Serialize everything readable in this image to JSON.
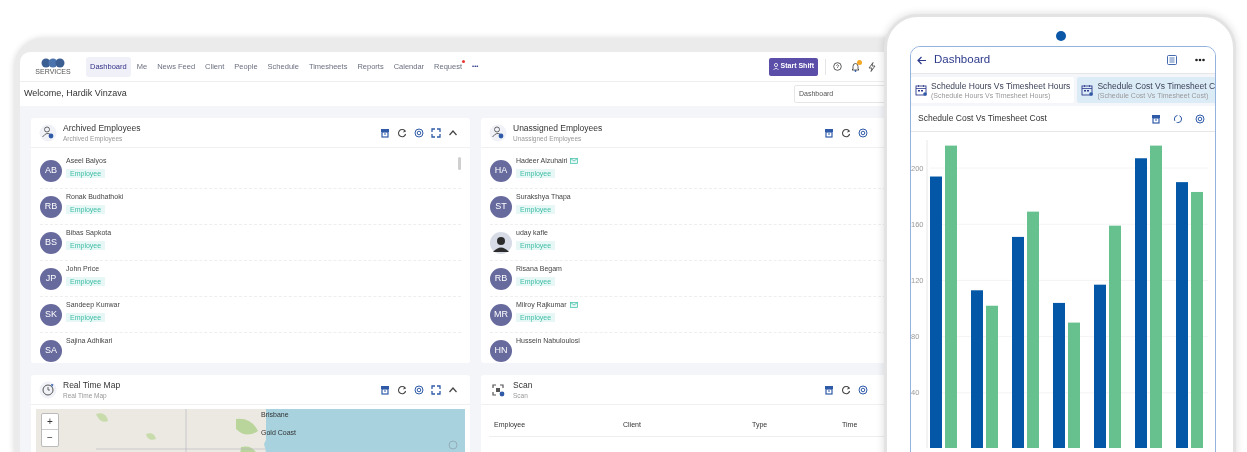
{
  "tablet": {
    "logo_text": "SERVICES",
    "nav": [
      {
        "label": "Dashboard",
        "selected": true
      },
      {
        "label": "Me",
        "selected": false
      },
      {
        "label": "News Feed",
        "selected": false
      },
      {
        "label": "Client",
        "selected": false
      },
      {
        "label": "People",
        "selected": false
      },
      {
        "label": "Schedule",
        "selected": false
      },
      {
        "label": "Timesheets",
        "selected": false
      },
      {
        "label": "Reports",
        "selected": false
      },
      {
        "label": "Calendar",
        "selected": false
      },
      {
        "label": "Request",
        "selected": false,
        "badge": true
      }
    ],
    "more": "•••",
    "start_shift": "Start Shift",
    "notification_dot": true,
    "welcome": "Welcome, Hardik Vinzava",
    "dashboard_select": "Dashboard",
    "cards": [
      {
        "kind": "people",
        "title": "Archived Employees",
        "subtitle": "Archived Employees",
        "scrollbar": true,
        "rows": [
          {
            "initials": "AB",
            "name": "Aseel Balyos",
            "tag": "Employee"
          },
          {
            "initials": "RB",
            "name": "Ronak Budhathoki",
            "tag": "Employee"
          },
          {
            "initials": "BS",
            "name": "Bibas Sapkota",
            "tag": "Employee"
          },
          {
            "initials": "JP",
            "name": "John Price",
            "tag": "Employee"
          },
          {
            "initials": "SK",
            "name": "Sandeep Kunwar",
            "tag": "Employee"
          },
          {
            "initials": "SA",
            "name": "Sajina Adhikari"
          }
        ]
      },
      {
        "kind": "people",
        "title": "Unassigned Employees",
        "subtitle": "Unassigned Employees",
        "scrollbar": false,
        "rows": [
          {
            "initials": "HA",
            "name": "Hadeer Alzuhairi",
            "tag": "Employee",
            "mail": true
          },
          {
            "initials": "ST",
            "name": "Surakshya Thapa",
            "tag": "Employee"
          },
          {
            "photo": true,
            "name": "uday kafle",
            "tag": "Employee"
          },
          {
            "initials": "RB",
            "name": "Risana Begam",
            "tag": "Employee"
          },
          {
            "initials": "MR",
            "name": "Milroy Rajkumar",
            "tag": "Employee",
            "mail": true
          },
          {
            "initials": "HN",
            "name": "Hussein Nabuloulosi"
          }
        ]
      },
      {
        "kind": "map",
        "title": "Real Time Map",
        "subtitle": "Real Time Map",
        "zoom_in": "+",
        "zoom_out": "−",
        "places": [
          "Brisbane",
          "Gold Coast"
        ]
      },
      {
        "kind": "table",
        "title": "Scan",
        "subtitle": "Scan",
        "columns": [
          "Employee",
          "Client",
          "Type",
          "Time"
        ]
      }
    ]
  },
  "phone": {
    "title": "Dashboard",
    "tabs": [
      {
        "title": "Schedule Hours Vs Timesheet Hours",
        "subtitle": "(Schedule Hours Vs Timesheet Hours)",
        "selected": false
      },
      {
        "title": "Schedule Cost Vs Timesheet C",
        "subtitle": "(Schedule Cost Vs Timesheet Cost)",
        "selected": true
      }
    ],
    "card_title": "Schedule Cost Vs Timesheet Cost",
    "chart_data": {
      "type": "bar",
      "grid": true,
      "ylim": [
        0,
        220
      ],
      "yticks": [
        40,
        80,
        120,
        160,
        200
      ],
      "series": [
        {
          "color": "#0457a7",
          "values": [
            194,
            113,
            151,
            104,
            117,
            207,
            190
          ]
        },
        {
          "color": "#66c18f",
          "values": [
            216,
            102,
            169,
            90,
            159,
            216,
            183
          ]
        }
      ]
    }
  }
}
